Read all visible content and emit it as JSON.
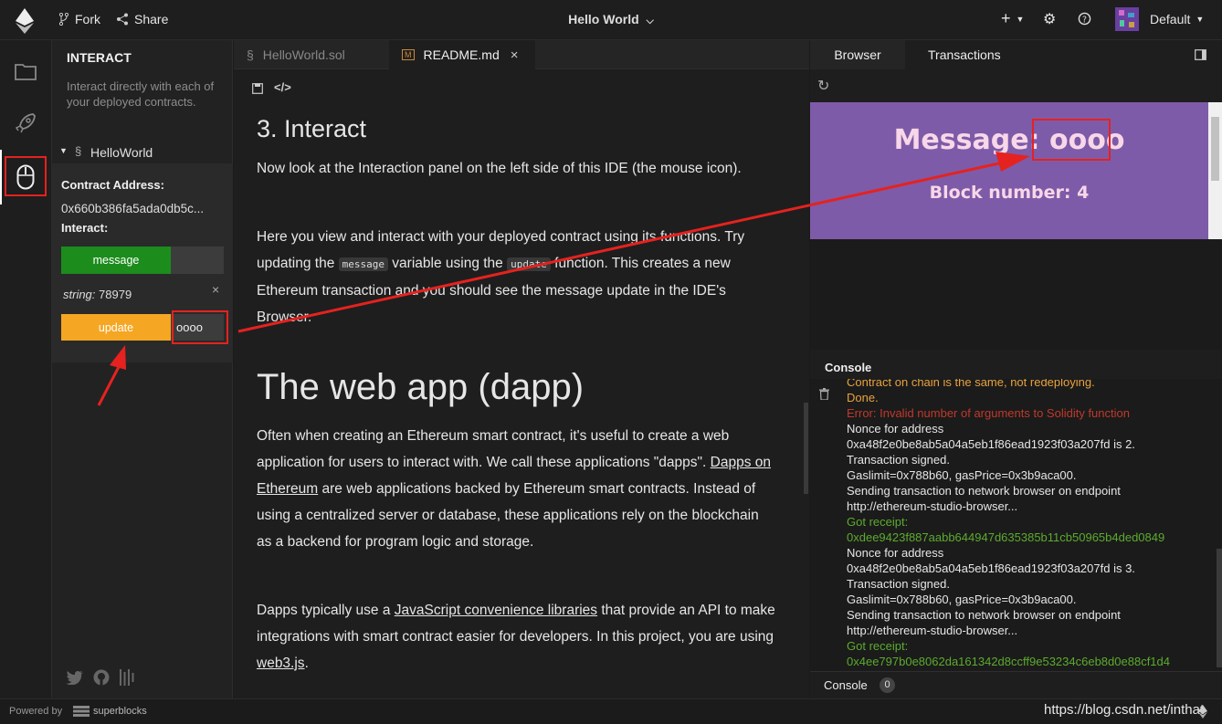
{
  "topbar": {
    "fork": "Fork",
    "share": "Share",
    "project_title": "Hello World",
    "user": "Default"
  },
  "leftpanel": {
    "title": "INTERACT",
    "description": "Interact directly with each of your deployed contracts.",
    "contract_name": "HelloWorld",
    "address_label": "Contract Address:",
    "address_value": "0x660b386fa5ada0db5c...",
    "interact_label": "Interact:",
    "message_button": "message",
    "string_type": "string:",
    "string_value": "78979",
    "update_button": "update",
    "update_input_value": "oooo"
  },
  "tabs": [
    {
      "label": "HelloWorld.sol"
    },
    {
      "label": "README.md"
    }
  ],
  "readme": {
    "h_interact": "3. Interact",
    "p1": "Now look at the Interaction panel on the left side of this IDE (the mouse icon).",
    "p2_a": "Here you view and interact with your deployed contract using its functions. Try updating the ",
    "p2_code1": "message",
    "p2_b": " variable using the ",
    "p2_code2": "update",
    "p2_c": " function. This creates a new Ethereum transaction and you should see the message update in the IDE's Browser.",
    "h_webapp": "The web app (dapp)",
    "p3_a": "Often when creating an Ethereum smart contract, it's useful to create a web application for users to interact with. We call these applications \"dapps\". ",
    "p3_link": "Dapps on Ethereum",
    "p3_b": " are web applications backed by Ethereum smart contracts. Instead of using a centralized server or database, these applications rely on the blockchain as a backend for program logic and storage.",
    "p4_a": "Dapps typically use a ",
    "p4_link": "JavaScript convenience libraries",
    "p4_b": " that provide an API to make integrations with smart contract easier for developers. In this project, you are using ",
    "p4_link2": "web3.js",
    "p4_c": "."
  },
  "rightpanel": {
    "tab_browser": "Browser",
    "tab_transactions": "Transactions",
    "message_line": "Message: oooo",
    "block_line": "Block number: 4",
    "console_header": "Console",
    "console_footer_label": "Console",
    "console_count": "0"
  },
  "console_lines": [
    {
      "text": "Contract on chain is the same, not redeploying.",
      "color": "#e8a33d"
    },
    {
      "text": "Done.",
      "color": "#e8a33d"
    },
    {
      "text": "Error: Invalid number of arguments to Solidity function",
      "color": "#c0392b"
    },
    {
      "text": "Nonce for address",
      "color": "#e6e6e6"
    },
    {
      "text": "0xa48f2e0be8ab5a04a5eb1f86ead1923f03a207fd is 2.",
      "color": "#e6e6e6"
    },
    {
      "text": "Transaction signed.",
      "color": "#e6e6e6"
    },
    {
      "text": "Gaslimit=0x788b60, gasPrice=0x3b9aca00.",
      "color": "#e6e6e6"
    },
    {
      "text": "Sending transaction to network browser on endpoint",
      "color": "#e6e6e6"
    },
    {
      "text": "http://ethereum-studio-browser...",
      "color": "#e6e6e6"
    },
    {
      "text": "Got receipt:",
      "color": "#5cab2e"
    },
    {
      "text": "0xdee9423f887aabb644947d635385b11cb50965b4ded0849",
      "color": "#5cab2e"
    },
    {
      "text": "Nonce for address",
      "color": "#e6e6e6"
    },
    {
      "text": "0xa48f2e0be8ab5a04a5eb1f86ead1923f03a207fd is 3.",
      "color": "#e6e6e6"
    },
    {
      "text": "Transaction signed.",
      "color": "#e6e6e6"
    },
    {
      "text": "Gaslimit=0x788b60, gasPrice=0x3b9aca00.",
      "color": "#e6e6e6"
    },
    {
      "text": "Sending transaction to network browser on endpoint",
      "color": "#e6e6e6"
    },
    {
      "text": "http://ethereum-studio-browser...",
      "color": "#e6e6e6"
    },
    {
      "text": "Got receipt:",
      "color": "#5cab2e"
    },
    {
      "text": "0x4ee797b0e8062da161342d8ccff9e53234c6eb8d0e88cf1d4",
      "color": "#5cab2e"
    }
  ],
  "statusbar": {
    "powered_by": "Powered by",
    "brand": "superblocks",
    "watermark": "https://blog.csdn.net/inthat"
  }
}
